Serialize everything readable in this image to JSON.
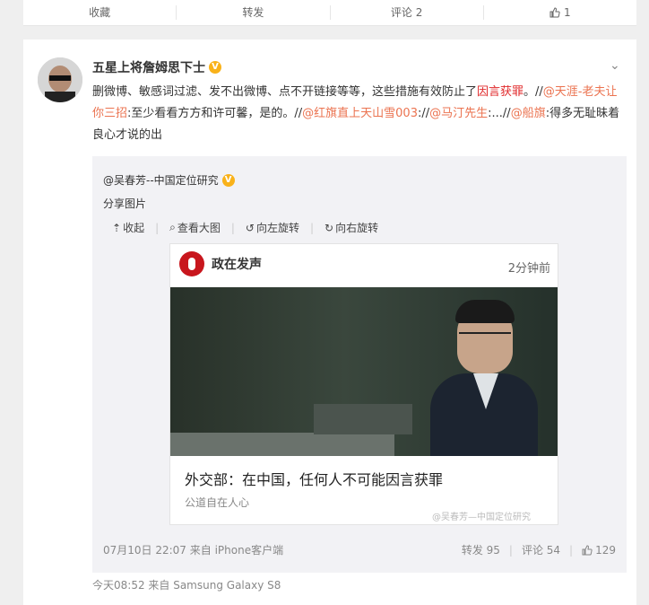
{
  "prev_actions": {
    "favorite": "收藏",
    "repost": "转发",
    "comment": "评论 2",
    "like_count": "1"
  },
  "post": {
    "username": "五星上将詹姆思下士",
    "text_parts": [
      "删微博、敏感词过滤、发不出微博、点不开链接等等，这些措施有效防止了",
      "因言获罪",
      "。//",
      "@天涯-老夫让你三招",
      ":至少看看方方和许可馨，是的。//",
      "@红旗直上天山雪003",
      "://",
      "@马汀先生",
      ":...//",
      "@船旗",
      ":得多无耻昧着良心才说的出"
    ],
    "meta": "今天08:52 来自 Samsung Galaxy S8"
  },
  "repost": {
    "author": "@吴春芳--中国定位研究",
    "share_text": "分享图片",
    "tools": {
      "collapse": "收起",
      "view_large": "查看大图",
      "rotate_left": "向左旋转",
      "rotate_right": "向右旋转"
    },
    "image": {
      "source": "政在发声",
      "time": "2分钟前",
      "headline": "外交部：在中国，任何人不可能因言获罪",
      "subtitle": "公道自在人心",
      "watermark": "@吴春芳—中国定位研究"
    },
    "footer": {
      "date": "07月10日 22:07 来自 iPhone客户端",
      "repost": "转发 95",
      "comment": "评论 54",
      "like": "129"
    }
  },
  "colors": {
    "link": "#eb7350",
    "highlight": "#e0292b",
    "badge": "#f9b21a"
  }
}
